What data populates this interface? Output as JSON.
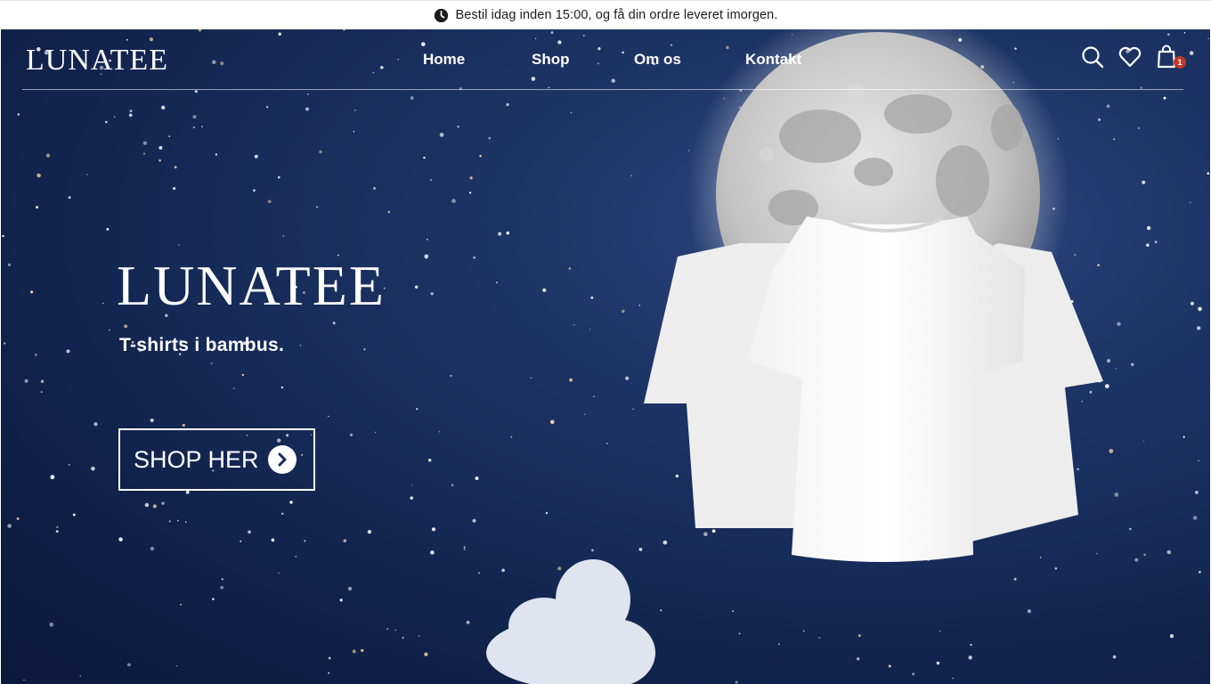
{
  "announcement": {
    "icon": "clock-icon",
    "text": "Bestil idag inden 15:00, og få din ordre leveret imorgen."
  },
  "header": {
    "logo": "LUNATEE",
    "nav": [
      {
        "label": "Home"
      },
      {
        "label": "Shop"
      },
      {
        "label": "Om os"
      },
      {
        "label": "Kontakt"
      }
    ],
    "icons": [
      "search-icon",
      "heart-icon",
      "shopping-bag-icon"
    ],
    "cart_count": "1"
  },
  "hero": {
    "title": "LUNATEE",
    "subtitle": "T-shirts i bambus.",
    "cta_label": "SHOP HER",
    "cta_icon": "chevron-right-icon"
  },
  "colors": {
    "sky": "#152a57",
    "text": "#ffffff",
    "badge": "#c0392b"
  }
}
